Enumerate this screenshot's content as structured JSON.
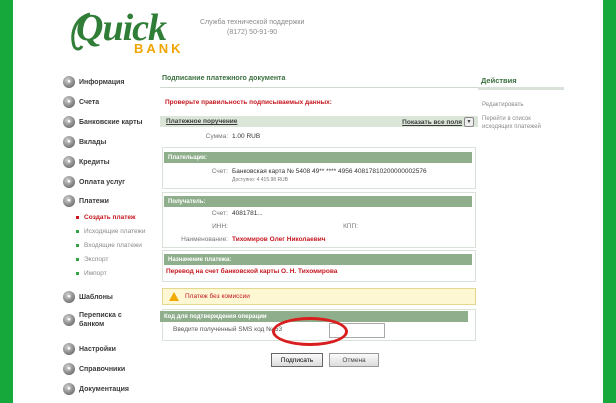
{
  "header": {
    "logo_text": "Quick",
    "logo_sub": "BANK",
    "support_title": "Служба технической поддержки",
    "support_phone": "(8172) 50-91-90"
  },
  "sidebar": {
    "items": [
      {
        "label": "Информация",
        "icon": "info-icon"
      },
      {
        "label": "Счета",
        "icon": "accounts-icon"
      },
      {
        "label": "Банковские карты",
        "icon": "cards-icon"
      },
      {
        "label": "Вклады",
        "icon": "deposits-icon"
      },
      {
        "label": "Кредиты",
        "icon": "credits-icon"
      },
      {
        "label": "Оплата услуг",
        "icon": "services-icon"
      },
      {
        "label": "Платежи",
        "icon": "payments-icon"
      },
      {
        "label": "Шаблоны",
        "icon": "templates-icon"
      },
      {
        "label": "Переписка с",
        "label2": "банком",
        "icon": "mail-icon"
      },
      {
        "label": "Настройки",
        "icon": "settings-icon"
      },
      {
        "label": "Справочники",
        "icon": "references-icon"
      },
      {
        "label": "Документация",
        "icon": "docs-icon"
      }
    ],
    "subitems": [
      {
        "label": "Создать платеж",
        "active": true
      },
      {
        "label": "Исходящие платежи",
        "active": false
      },
      {
        "label": "Входящие платежи",
        "active": false
      },
      {
        "label": "Экспорт",
        "active": false
      },
      {
        "label": "Импорт",
        "active": false
      }
    ]
  },
  "main": {
    "title": "Подписание платежного документа",
    "warning": "Проверьте правильность подписываемых данных:",
    "doc_link": "Платежное поручение",
    "show_all": "Показать все поля",
    "sum_label": "Сумма:",
    "sum_value": "1.00 RUB",
    "payer_head": "Плательщик:",
    "payer_acc_label": "Счет:",
    "payer_acc_value": "Банковская карта № 5408 49** **** 4956 40817810200000002576",
    "payer_avail": "Доступно: 4 415.98 RUB",
    "recipient_head": "Получатель:",
    "rec_acc_label": "Счет:",
    "rec_acc_value": "4081781...",
    "inn_label": "ИНН:",
    "kpp_label": "КПП:",
    "name_label": "Наименование:",
    "name_value": "Тихомиров Олег Николаевич",
    "purpose_head": "Назначение платежа:",
    "purpose_value": "Перевод на счет банковской карты О. Н. Тихомирова",
    "notice": "Платеж без комиссии",
    "sms_head": "Код для подтверждения операции",
    "sms_label": "Введите полученный SMS код № 53",
    "sign_button": "Подписать",
    "cancel_button": "Отмена"
  },
  "actions": {
    "title": "Действия",
    "edit": "Редактировать",
    "goto1": "Перейти в список",
    "goto2": "исходящих платежей"
  },
  "colors": {
    "frame": "#17a83c",
    "accent_red": "#c6171f",
    "header_green": "#8fae8c"
  }
}
